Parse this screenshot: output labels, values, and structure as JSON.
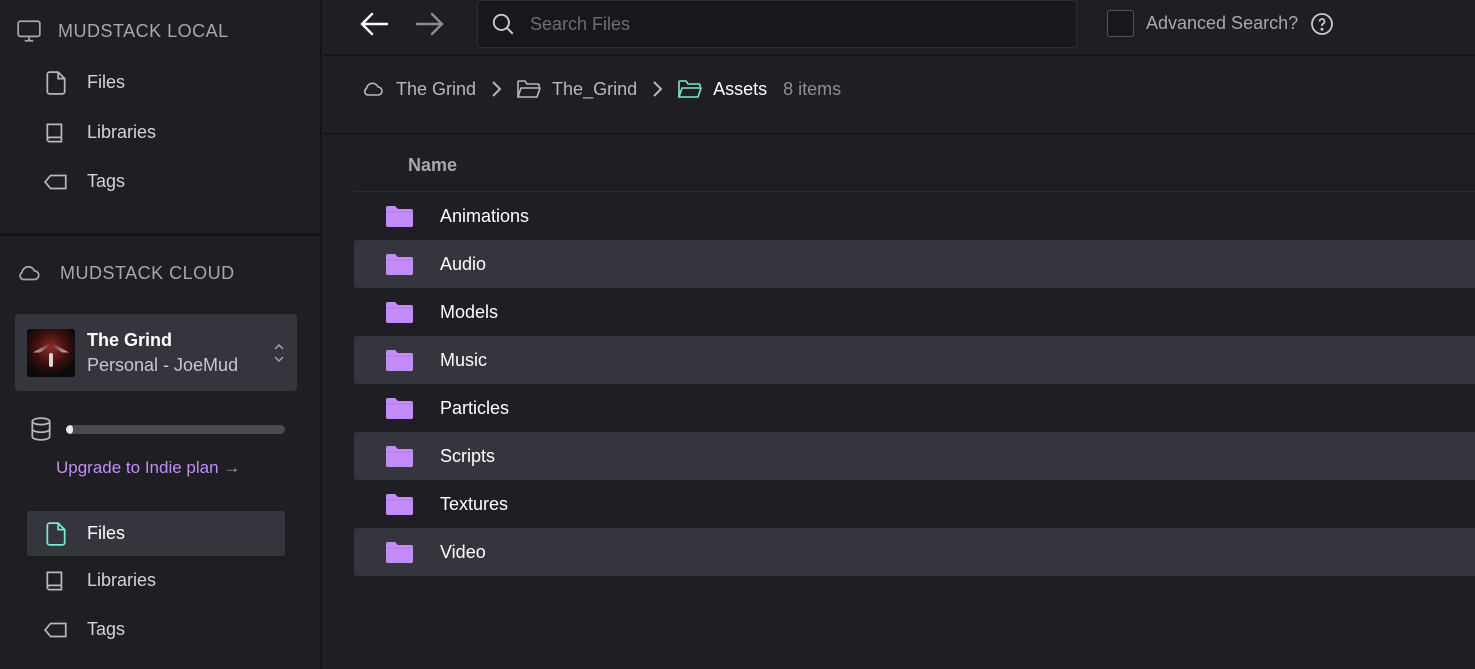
{
  "colors": {
    "accent_purple": "#c48cf8",
    "folder_purple": "#c48cf8",
    "active_file_teal": "#7be8d0"
  },
  "sidebar": {
    "local": {
      "heading": "MUDSTACK LOCAL",
      "items": [
        {
          "label": "Files",
          "icon": "file-icon"
        },
        {
          "label": "Libraries",
          "icon": "book-icon"
        },
        {
          "label": "Tags",
          "icon": "tag-icon"
        }
      ]
    },
    "cloud": {
      "heading": "MUDSTACK CLOUD",
      "project": {
        "name": "The Grind",
        "subtitle": "Personal - JoeMud"
      },
      "storage_used_fraction": 0.03,
      "upgrade_label": "Upgrade to Indie plan →",
      "items": [
        {
          "label": "Files",
          "icon": "file-icon",
          "active": true
        },
        {
          "label": "Libraries",
          "icon": "book-icon"
        },
        {
          "label": "Tags",
          "icon": "tag-icon"
        }
      ]
    }
  },
  "toolbar": {
    "search_placeholder": "Search Files",
    "advanced_search_label": "Advanced Search?"
  },
  "breadcrumb": {
    "items": [
      "The Grind",
      "The_Grind",
      "Assets"
    ],
    "item_count": "8 items"
  },
  "table": {
    "column_name": "Name",
    "rows": [
      "Animations",
      "Audio",
      "Models",
      "Music",
      "Particles",
      "Scripts",
      "Textures",
      "Video"
    ]
  }
}
